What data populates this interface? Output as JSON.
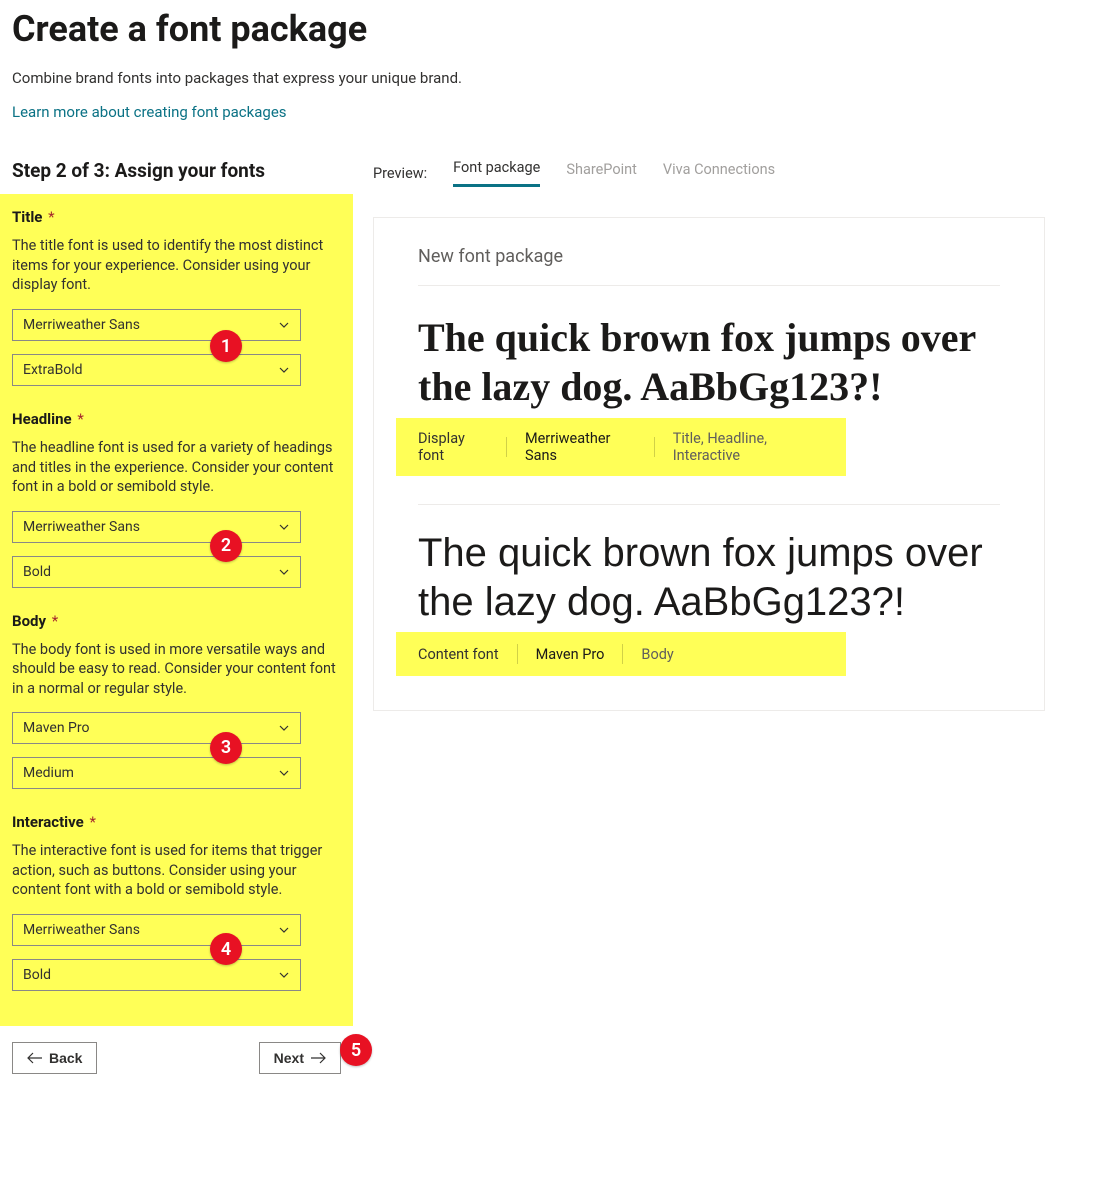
{
  "header": {
    "title": "Create a font package",
    "subtitle": "Combine brand fonts into packages that express your unique brand.",
    "learn_link": "Learn more about creating font packages"
  },
  "step": {
    "label": "Step 2 of 3: Assign your fonts"
  },
  "sections": {
    "title": {
      "label": "Title",
      "desc": "The title font is used to identify the most distinct items for your experience. Consider using your display font.",
      "font": "Merriweather Sans",
      "weight": "ExtraBold"
    },
    "headline": {
      "label": "Headline",
      "desc": "The headline font is used for a variety of headings and titles in the experience. Consider your content font in a bold or semibold style.",
      "font": "Merriweather Sans",
      "weight": "Bold"
    },
    "body": {
      "label": "Body",
      "desc": "The body font is used in more versatile ways and should be easy to read. Consider your content font in a normal or regular style.",
      "font": "Maven Pro",
      "weight": "Medium"
    },
    "interactive": {
      "label": "Interactive",
      "desc": "The interactive font is used for items that trigger action, such as buttons. Consider using your content font with a bold or semibold style.",
      "font": "Merriweather Sans",
      "weight": "Bold"
    }
  },
  "buttons": {
    "back": "Back",
    "next": "Next"
  },
  "preview": {
    "label": "Preview:",
    "tabs": {
      "font_package": "Font package",
      "sharepoint": "SharePoint",
      "viva": "Viva Connections"
    },
    "pkg_name": "New font package",
    "sample_text": "The quick brown fox jumps over the lazy dog. AaBbGg123?!",
    "display": {
      "label": "Display font",
      "name": "Merriweather Sans",
      "usage": "Title, Headline, Interactive"
    },
    "content": {
      "label": "Content font",
      "name": "Maven Pro",
      "usage": "Body"
    }
  },
  "callouts": {
    "c1": "1",
    "c2": "2",
    "c3": "3",
    "c4": "4",
    "c5": "5"
  }
}
